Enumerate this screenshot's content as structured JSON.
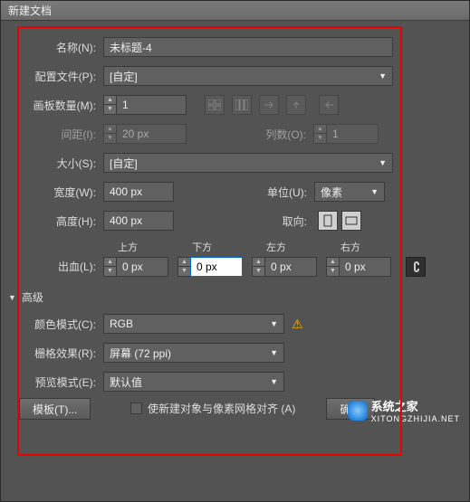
{
  "titlebar": "新建文档",
  "labels": {
    "name": "名称(N):",
    "profile": "配置文件(P):",
    "artboards": "画板数量(M):",
    "spacing": "间距(I):",
    "columns": "列数(O):",
    "size": "大小(S):",
    "width": "宽度(W):",
    "unit": "单位(U):",
    "height": "高度(H):",
    "orient": "取向:",
    "bleed": "出血(L):",
    "top": "上方",
    "bottom": "下方",
    "left": "左方",
    "right": "右方",
    "advanced": "高级",
    "colormode": "颜色模式(C):",
    "raster": "栅格效果(R):",
    "preview": "预览模式(E):",
    "align": "使新建对象与像素网格对齐 (A)",
    "template": "模板(T)...",
    "ok": "确定"
  },
  "values": {
    "name": "未标题-4",
    "profile": "[自定]",
    "artboards": "1",
    "spacing": "20 px",
    "columns": "1",
    "size": "[自定]",
    "width": "400 px",
    "height": "400 px",
    "unit": "像素",
    "bleed_top": "0 px",
    "bleed_bottom": "0 px",
    "bleed_left": "0 px",
    "bleed_right": "0 px",
    "colormode": "RGB",
    "raster": "屏幕 (72 ppi)",
    "preview": "默认值"
  },
  "watermark": {
    "name": "系统之家",
    "url": "XITONGZHIJIA.NET"
  }
}
